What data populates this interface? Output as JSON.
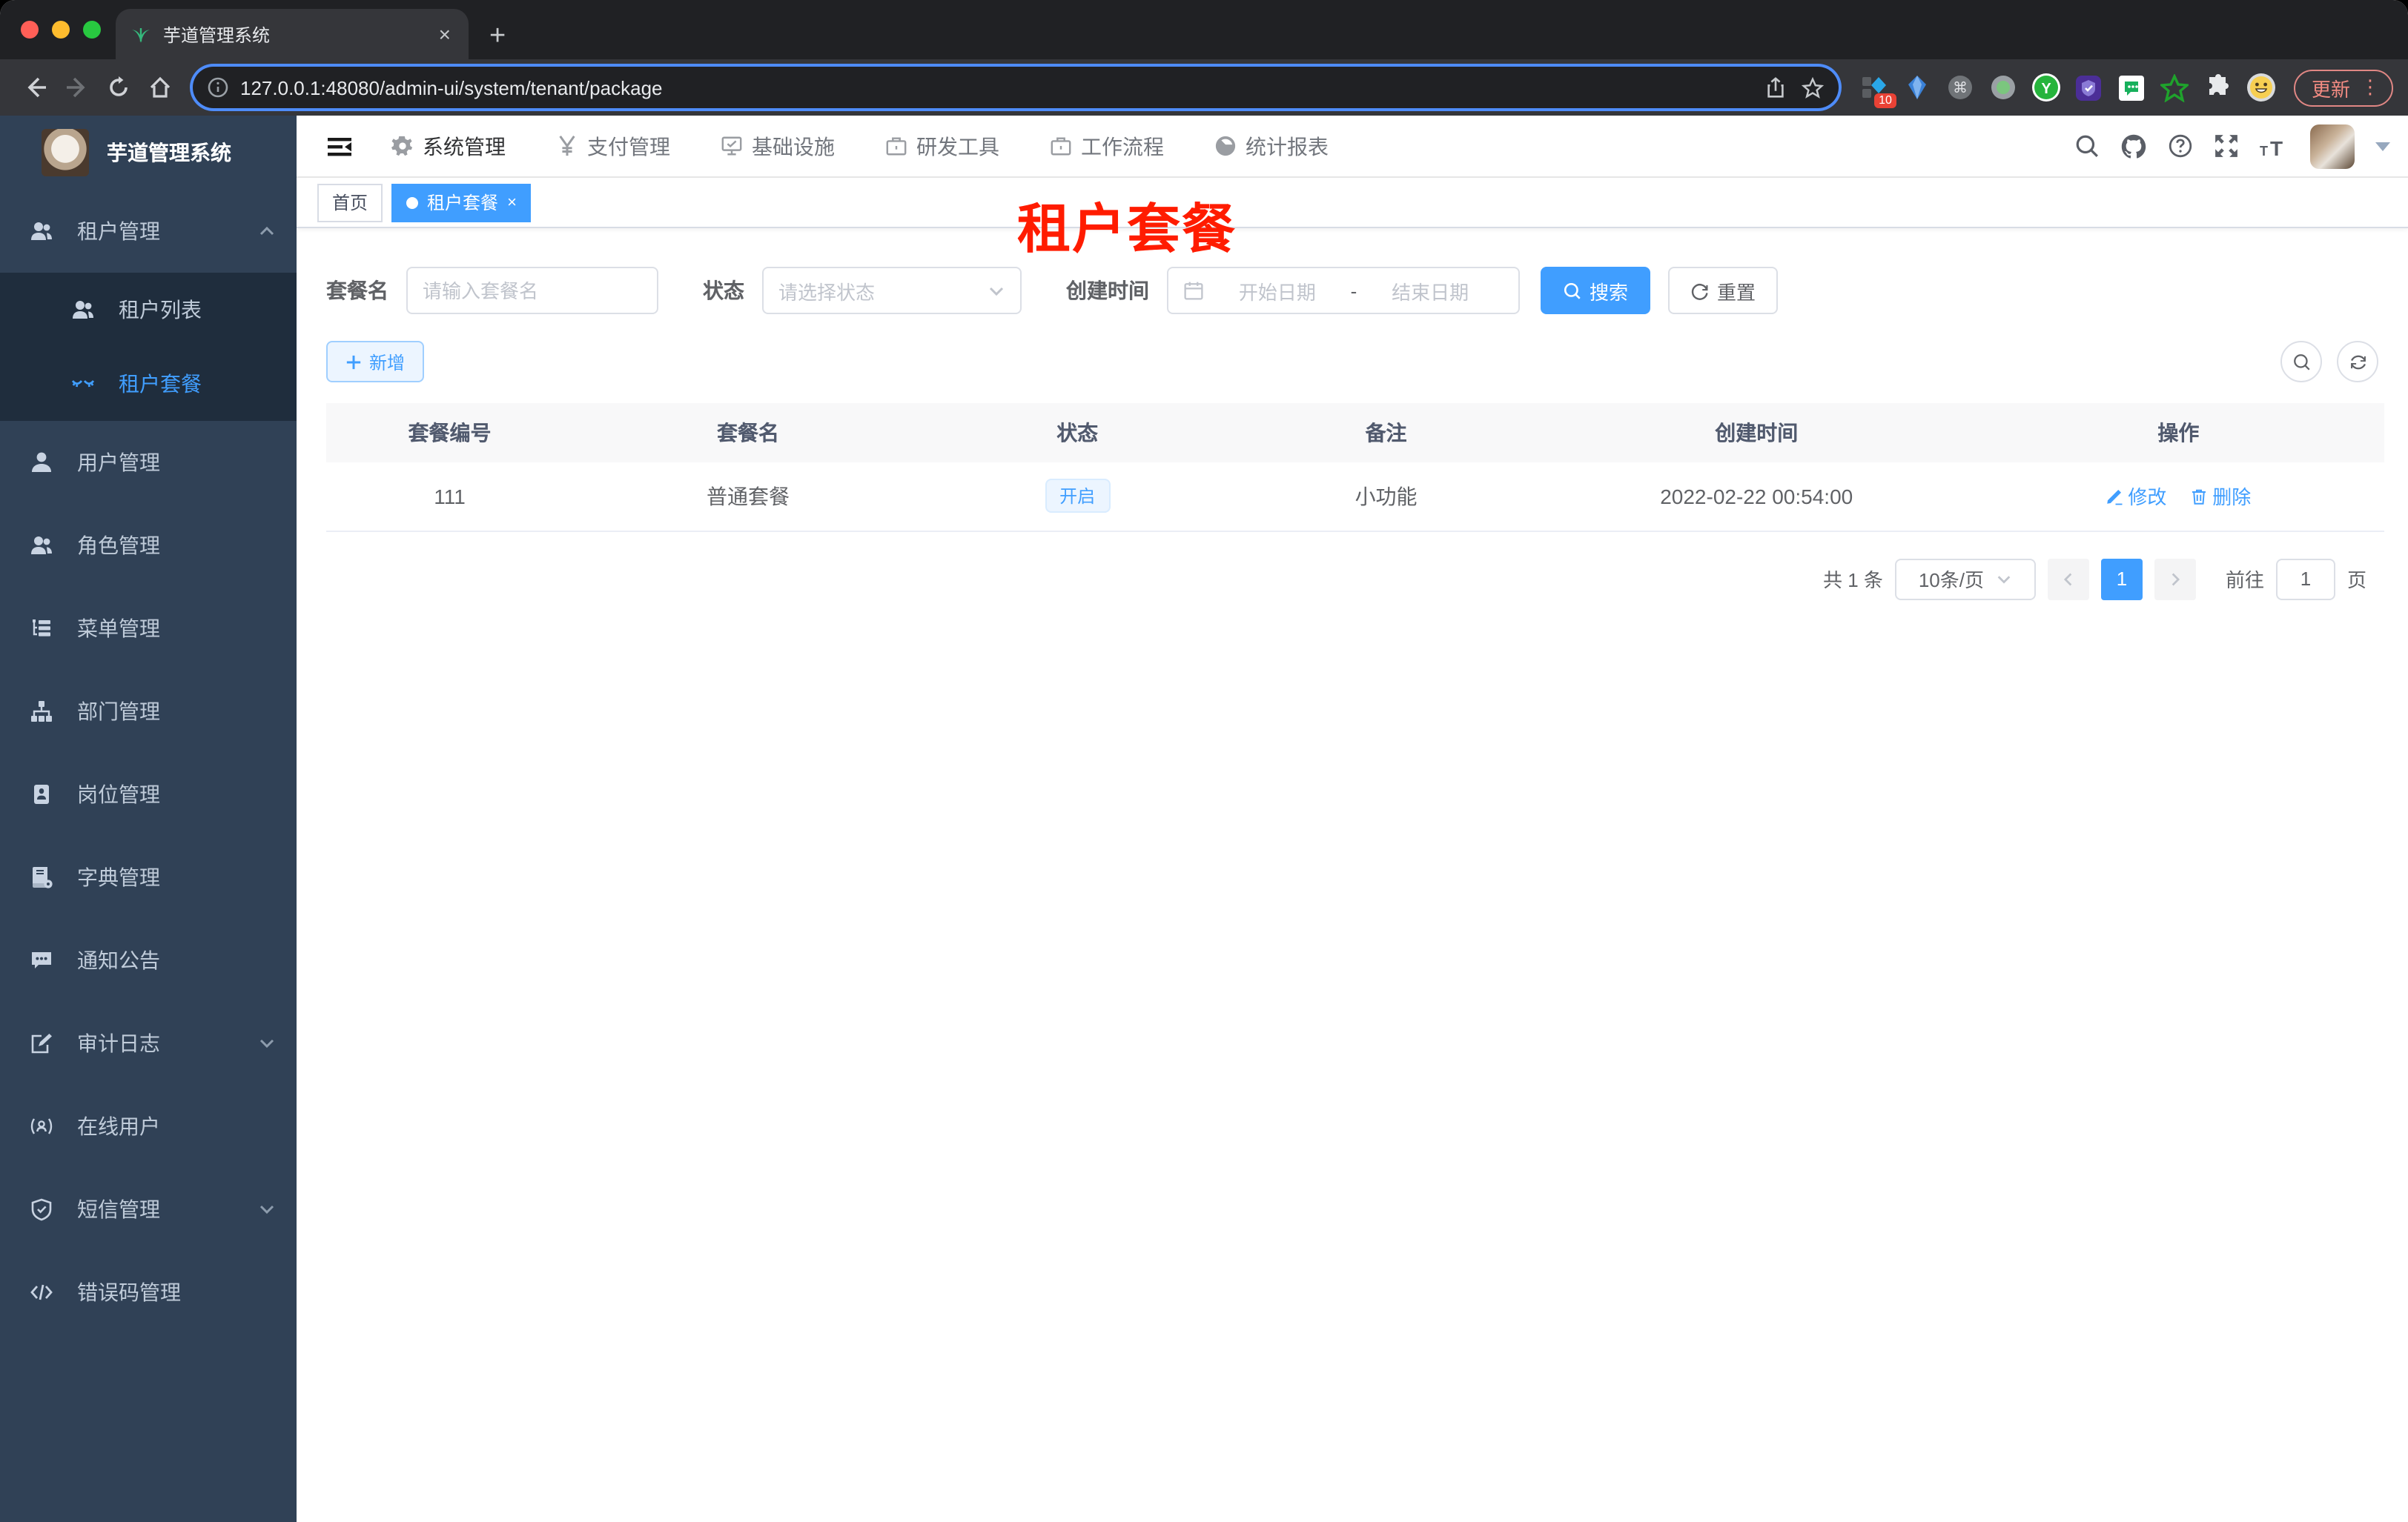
{
  "browser": {
    "tab_title": "芋道管理系统",
    "close_tab": "×",
    "new_tab": "+",
    "url": "127.0.0.1:48080/admin-ui/system/tenant/package",
    "extension_badge": "10",
    "extension_y_label": "Y",
    "update_label": "更新",
    "kebab": "⋮"
  },
  "sidebar": {
    "logo_title": "芋道管理系统",
    "items": [
      {
        "label": "租户管理",
        "icon": "peoples",
        "expanded": true,
        "children": [
          {
            "label": "租户列表",
            "icon": "peoples"
          },
          {
            "label": "租户套餐",
            "icon": "tenant-package",
            "active": true
          }
        ]
      },
      {
        "label": "用户管理",
        "icon": "user"
      },
      {
        "label": "角色管理",
        "icon": "peoples"
      },
      {
        "label": "菜单管理",
        "icon": "tree-table"
      },
      {
        "label": "部门管理",
        "icon": "org-tree"
      },
      {
        "label": "岗位管理",
        "icon": "id-badge"
      },
      {
        "label": "字典管理",
        "icon": "dict-book"
      },
      {
        "label": "通知公告",
        "icon": "message"
      },
      {
        "label": "审计日志",
        "icon": "log",
        "collapsible": true
      },
      {
        "label": "在线用户",
        "icon": "online-user"
      },
      {
        "label": "短信管理",
        "icon": "shield-check",
        "collapsible": true
      },
      {
        "label": "错误码管理",
        "icon": "code"
      }
    ]
  },
  "topnav": {
    "items": [
      {
        "label": "系统管理",
        "icon": "gear",
        "active": true
      },
      {
        "label": "支付管理",
        "icon": "yen"
      },
      {
        "label": "基础设施",
        "icon": "monitor"
      },
      {
        "label": "研发工具",
        "icon": "briefcase"
      },
      {
        "label": "工作流程",
        "icon": "briefcase"
      },
      {
        "label": "统计报表",
        "icon": "dashboard"
      }
    ]
  },
  "tags": {
    "home": "首页",
    "active": "租户套餐",
    "active_close": "×"
  },
  "overlay_title": "租户套餐",
  "filters": {
    "name_label": "套餐名",
    "name_placeholder": "请输入套餐名",
    "status_label": "状态",
    "status_placeholder": "请选择状态",
    "date_label": "创建时间",
    "date_start": "开始日期",
    "date_sep": "-",
    "date_end": "结束日期",
    "search_label": "搜索",
    "reset_label": "重置"
  },
  "toolbar": {
    "add_label": "新增"
  },
  "table": {
    "headers": [
      "套餐编号",
      "套餐名",
      "状态",
      "备注",
      "创建时间",
      "操作"
    ],
    "rows": [
      {
        "id": "111",
        "name": "普通套餐",
        "status": "开启",
        "remark": "小功能",
        "created": "2022-02-22 00:54:00",
        "edit_label": "修改",
        "delete_label": "删除"
      }
    ]
  },
  "pagination": {
    "total": "共 1 条",
    "page_size": "10条/页",
    "current_page": "1",
    "goto_label": "前往",
    "goto_value": "1",
    "unit_label": "页"
  },
  "colors": {
    "accent": "#409eff",
    "sidebar_bg": "#304156",
    "submenu_bg": "#1f2d3d",
    "annotation_red": "#ff1c00",
    "update_pill_red": "#f28b82",
    "status_tag_bg": "#ecf5ff"
  }
}
